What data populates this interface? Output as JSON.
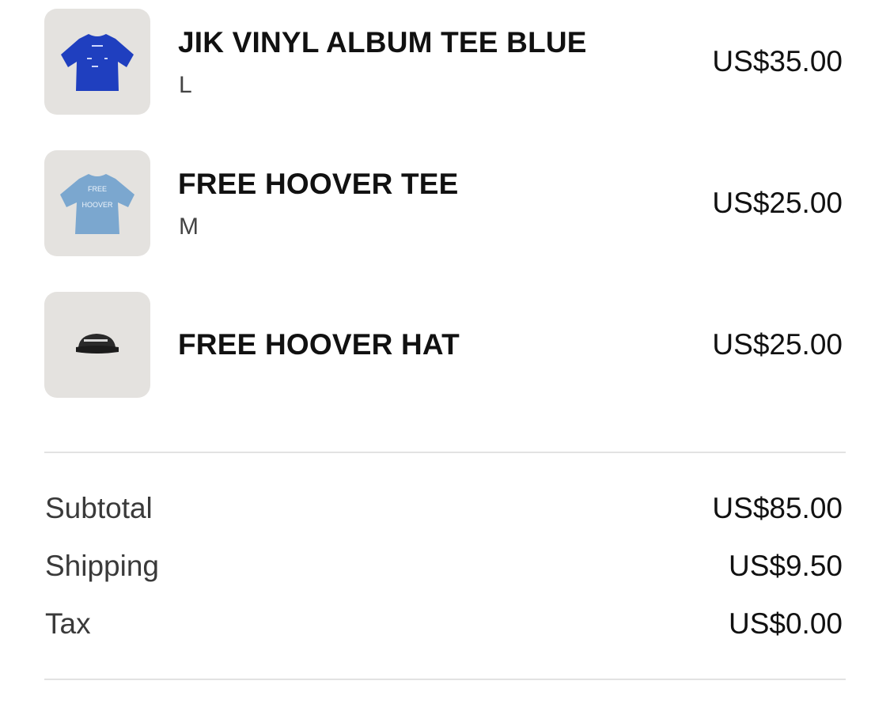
{
  "cart": {
    "items": [
      {
        "name": "JIK VINYL ALBUM TEE BLUE",
        "variant": "L",
        "price": "US$35.00",
        "thumbnail_icon": "blue-tshirt-icon",
        "shirt_color": "#1f3fbf"
      },
      {
        "name": "FREE HOOVER TEE",
        "variant": "M",
        "price": "US$25.00",
        "thumbnail_icon": "light-blue-tshirt-icon",
        "shirt_color": "#7ba7cf",
        "print_text_line1": "FREE",
        "print_text_line2": "HOOVER"
      },
      {
        "name": "FREE HOOVER HAT",
        "price": "US$25.00",
        "thumbnail_icon": "black-cap-icon",
        "cap_color": "#2a2a2a"
      }
    ]
  },
  "summary": {
    "subtotal_label": "Subtotal",
    "subtotal_value": "US$85.00",
    "shipping_label": "Shipping",
    "shipping_value": "US$9.50",
    "tax_label": "Tax",
    "tax_value": "US$0.00"
  },
  "colors": {
    "thumbnail_background": "#e4e2df",
    "divider": "#e2e2e2",
    "text_primary": "#111111",
    "text_secondary": "#3a3a3a"
  }
}
